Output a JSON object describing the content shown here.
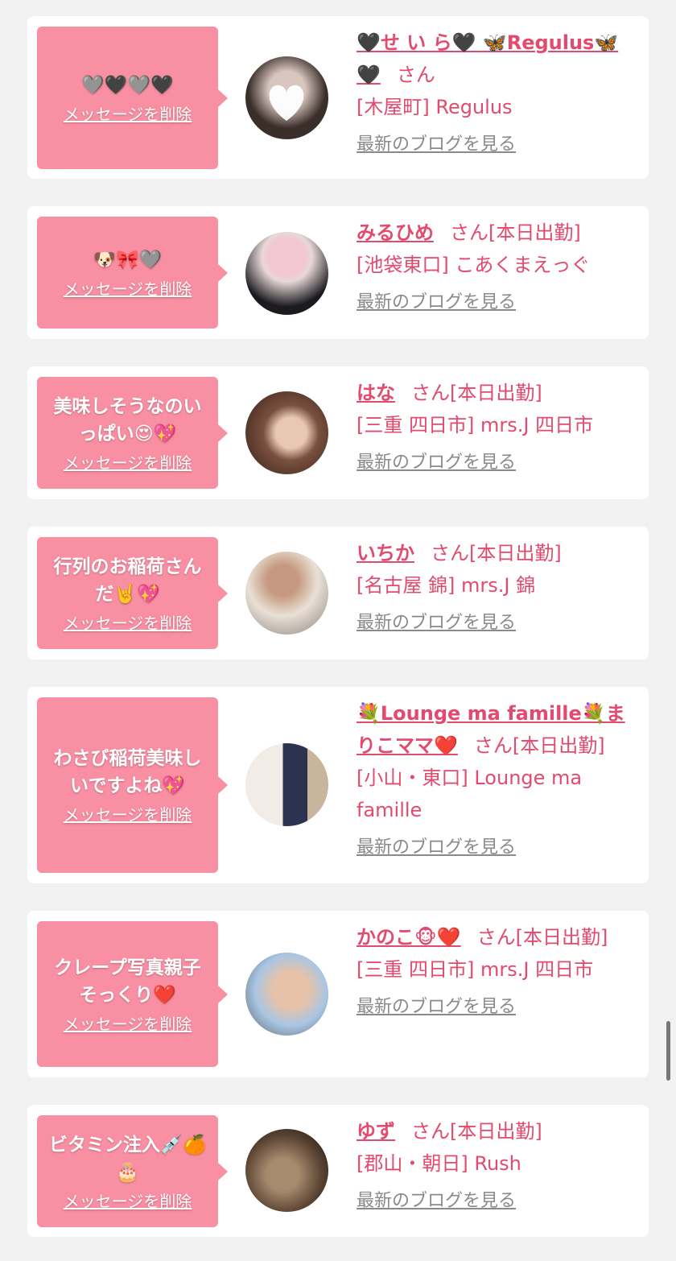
{
  "delete_label": "メッセージを削除",
  "blog_label": "最新のブログを見る",
  "san_label": "さん",
  "entries": [
    {
      "message": "🩶🖤🩶🖤",
      "name": "🖤せ い ら🖤 🦋Regulus🦋🖤",
      "status": "",
      "shop": "[木屋町] Regulus",
      "avatar_colors": [
        "#3a2e2a",
        "#d9c6bf"
      ]
    },
    {
      "message": "🐶🎀🩶",
      "name": "みるひめ",
      "status": "[本日出勤]",
      "shop": "[池袋東口] こあくまえっぐ",
      "avatar_colors": [
        "#1b1b1f",
        "#f2c6d2"
      ]
    },
    {
      "message": "美味しそうなのいっぱい😍💖",
      "name": "はな",
      "status": "[本日出勤]",
      "shop": "[三重 四日市] mrs.J 四日市",
      "avatar_colors": [
        "#5a3a2c",
        "#e8c8b0"
      ]
    },
    {
      "message": "行列のお稲荷さんだ🤘💖",
      "name": "いちか",
      "status": "[本日出勤]",
      "shop": "[名古屋 錦] mrs.J 錦",
      "avatar_colors": [
        "#e9e1d6",
        "#c59a80"
      ]
    },
    {
      "message": "わさび稲荷美味しいですよね💖",
      "name": "💐Lounge ma famille💐まりこママ❤️",
      "status": "[本日出勤]",
      "shop": "[小山・東口] Lounge ma famille",
      "avatar_colors": [
        "#f1ede6",
        "#2c3350"
      ]
    },
    {
      "message": "クレープ写真親子そっくり❤️",
      "name": "かのこ🐵❤️",
      "status": "[本日出勤]",
      "shop": "[三重 四日市] mrs.J 四日市",
      "avatar_colors": [
        "#a9c6e4",
        "#e7c2a8"
      ]
    },
    {
      "message": "ビタミン注入💉🍊🎂",
      "name": "ゆず",
      "status": "[本日出勤]",
      "shop": "[郡山・朝日] Rush",
      "avatar_colors": [
        "#5a4433",
        "#a88a6e"
      ]
    }
  ]
}
